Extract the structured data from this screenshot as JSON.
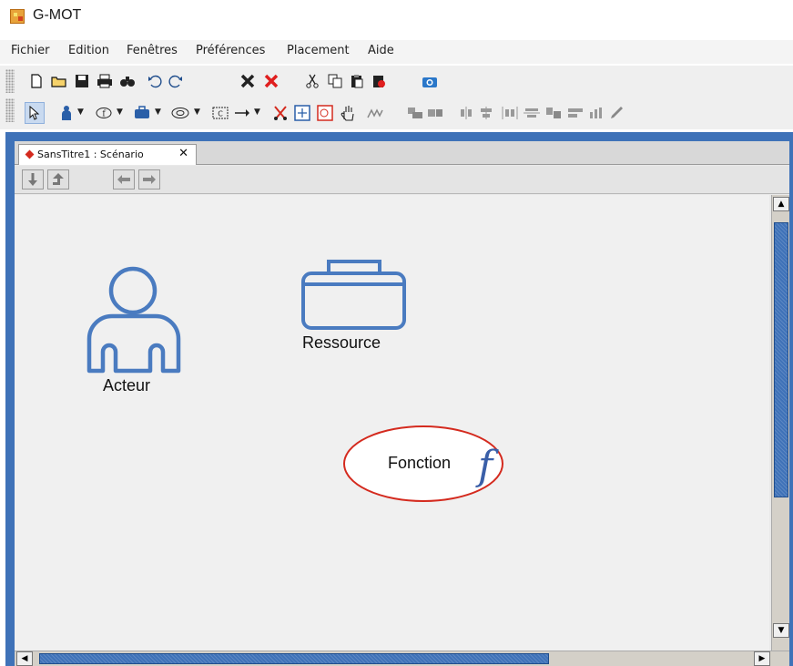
{
  "window": {
    "title": "G-MOT"
  },
  "menu": [
    "Fichier",
    "Edition",
    "Fenêtres",
    "Préférences",
    "Placement",
    "Aide"
  ],
  "toolbar1": {
    "icons": [
      "new-document-icon",
      "open-folder-icon",
      "save-icon",
      "print-icon",
      "find-icon",
      "undo-icon",
      "redo-icon",
      "delete-icon",
      "delete-red-icon",
      "cut-icon",
      "copy-icon",
      "paste-icon",
      "paste-special-icon",
      "camera-icon"
    ]
  },
  "toolbar2": {
    "icons": [
      "select-pointer-icon",
      "actor-tool-icon",
      "function-tool-icon",
      "resource-tool-icon",
      "ellipse-tool-icon",
      "frame-tool-icon",
      "arrow-tool-icon",
      "scissors-icon",
      "zoom-fit-icon",
      "zoom-region-icon",
      "hand-pan-icon",
      "align-icons"
    ]
  },
  "tab": {
    "label": "SansTitre1 : Scénario",
    "close": "✕"
  },
  "nav": {
    "buttons": [
      "down-arrow-icon",
      "up-level-icon",
      "back-arrow-icon",
      "forward-arrow-icon"
    ]
  },
  "diagram": {
    "actor_label": "Acteur",
    "resource_label": "Ressource",
    "function_label": "Fonction",
    "function_symbol": "f"
  },
  "colors": {
    "accent_blue": "#3f72b8",
    "shape_stroke": "#4a7bc0",
    "ellipse_stroke": "#d42a1e",
    "function_symbol": "#3a5fa8"
  }
}
